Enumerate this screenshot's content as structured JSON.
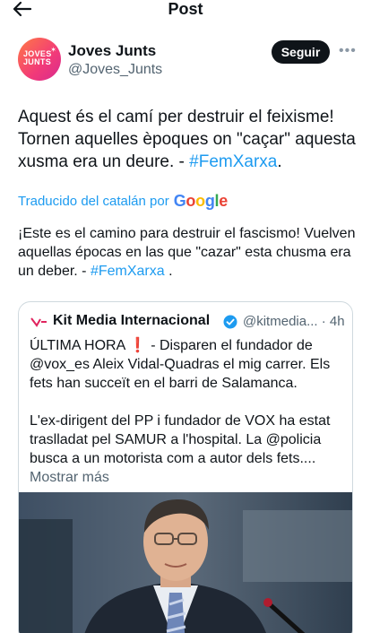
{
  "header": {
    "title": "Post"
  },
  "author": {
    "display_name": "Joves Junts",
    "handle": "@Joves_Junts",
    "avatar_text_line1": "JOVES",
    "avatar_text_line2": "JUNTS",
    "follow_label": "Seguir"
  },
  "tweet": {
    "text": "Aquest és el camí per destruir el feixisme! Tornen aquelles èpoques on \"caçar\" aquesta xusma era un deure. - ",
    "hashtag": "#FemXarxa",
    "suffix": "."
  },
  "translation": {
    "label": "Traducido del catalán por",
    "provider": "Google",
    "text": "¡Este es el camino para destruir el fascismo! Vuelven aquellas épocas en las que \"cazar\" esta chusma era un deber. - ",
    "hashtag": "#FemXarxa",
    "suffix": " ."
  },
  "quoted": {
    "name": "Kit Media Internacional",
    "handle": "@kitmedia...",
    "time": "· 4h",
    "line1_prefix": "ÚLTIMA HORA",
    "line1_mark": "❗",
    "line1_rest": " - Disparen el fundador de @vox_es Aleix Vidal-Quadras el mig carrer. Els fets han succeït en el barri de Salamanca.",
    "paragraph2": "L'ex-dirigent del PP i fundador de VOX ha estat traslladat pel SAMUR a l'hospital. La @policia busca a un motorista com a autor dels fets.... ",
    "show_more": "Mostrar más"
  },
  "colors": {
    "accent": "#1d9bf0",
    "text": "#0f1419",
    "muted": "#536471",
    "border": "#cfd9de"
  },
  "icons": {
    "back": "arrow-left-icon",
    "more": "more-horizontal-icon",
    "verified": "verified-badge-icon"
  }
}
